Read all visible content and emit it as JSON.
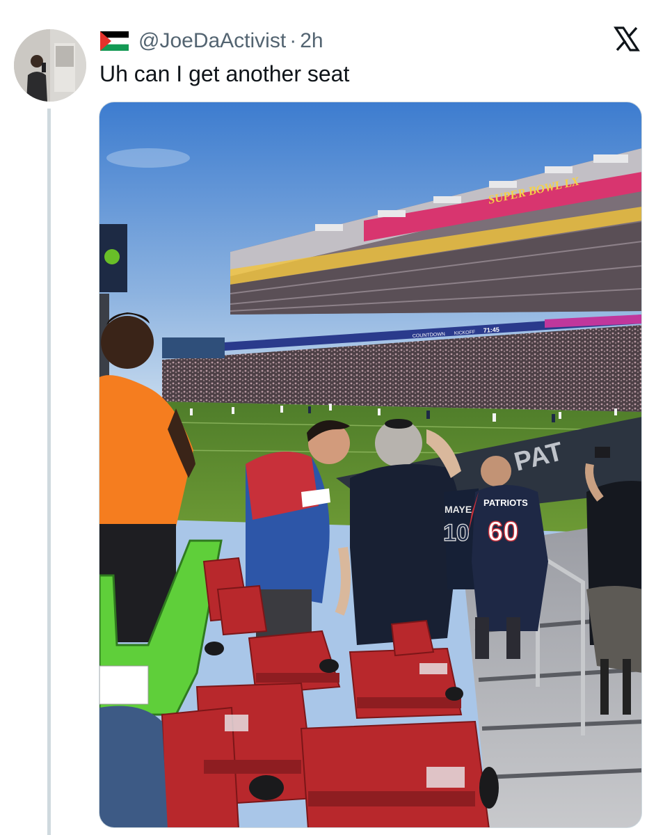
{
  "author": {
    "handle": "@JoeDaActivist",
    "separator": "·",
    "time": "2h",
    "flag_icon": "palestine-flag-icon",
    "avatar_icon": "profile-photo"
  },
  "tweet": {
    "text": "Uh can I get another seat"
  },
  "platform_icon": "x-logo-icon",
  "photo": {
    "banner_text": "SUPER BOWL LX",
    "scoreboard_countdown": "COUNTDOWN",
    "scoreboard_kickoff": "KICKOFF",
    "scoreboard_time": "71:45",
    "jersey_name": "MAYE",
    "jersey_number": "10",
    "jersey_team": "PATRIOTS",
    "jersey_number_2": "60"
  },
  "colors": {
    "sky_top": "#3f7fd0",
    "sky_bottom": "#c9dcef",
    "field_green": "#5f8e2e",
    "seat_red": "#b8282c",
    "accent_text": "#536471"
  }
}
